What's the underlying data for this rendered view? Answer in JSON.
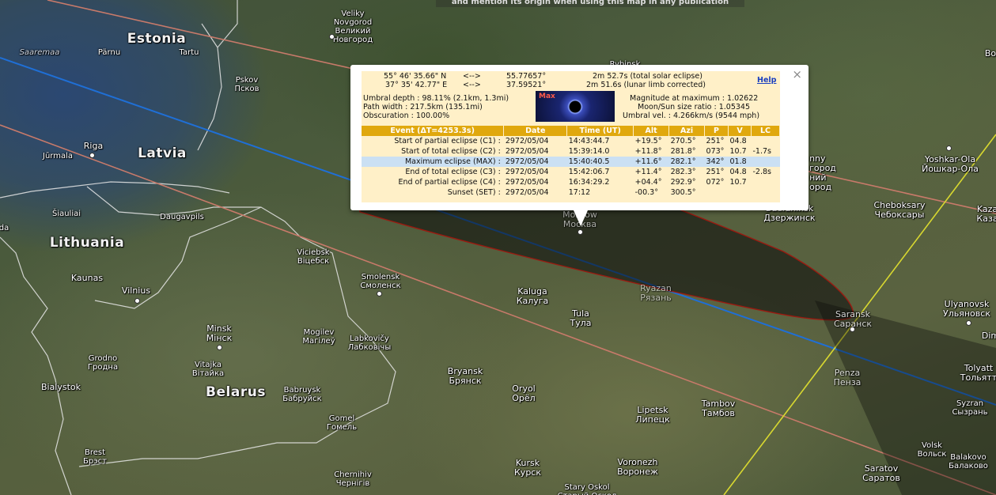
{
  "credit_text": "and mention its origin when using this map in any publication",
  "countries": [
    "Estonia",
    "Latvia",
    "Lithuania",
    "Belarus"
  ],
  "sea_labels": [
    "Saaremaa"
  ],
  "cities": [
    {
      "name": "Veliky\nNovgorod\nВеликий\nНовгород"
    },
    {
      "name": "Pärnu"
    },
    {
      "name": "Tartu"
    },
    {
      "name": "Pskov\nПсков"
    },
    {
      "name": "Jūrmala"
    },
    {
      "name": "Riga"
    },
    {
      "name": "Šiauliai"
    },
    {
      "name": "Daugavpils"
    },
    {
      "name": "Kaunas"
    },
    {
      "name": "Vilnius"
    },
    {
      "name": "Viciebsk\nВіцебск"
    },
    {
      "name": "Smolensk\nСмоленск"
    },
    {
      "name": "Minsk\nМінск"
    },
    {
      "name": "Mogilev\nМагілеў"
    },
    {
      "name": "Labkovičy\nЛабковічы"
    },
    {
      "name": "Grodno\nГродна"
    },
    {
      "name": "Vitajka\nВітайка"
    },
    {
      "name": "Bialystok"
    },
    {
      "name": "Babruysk\nБабруйск"
    },
    {
      "name": "Gomel\nГомель"
    },
    {
      "name": "Brest\nБрэст"
    },
    {
      "name": "Chernihiv\nЧернігів"
    },
    {
      "name": "Kaluga\nКалуга"
    },
    {
      "name": "Tula\nТула"
    },
    {
      "name": "Moscow\nМосква"
    },
    {
      "name": "Ryazan\nРязань"
    },
    {
      "name": "Bryansk\nБрянск"
    },
    {
      "name": "Oryol\nОрёл"
    },
    {
      "name": "Lipetsk\nЛипецк"
    },
    {
      "name": "Tambov\nТамбов"
    },
    {
      "name": "Kursk\nКурск"
    },
    {
      "name": "Voronezh\nВоронеж"
    },
    {
      "name": "Stary Oskol\nСтарый Оскол"
    },
    {
      "name": "Saransk\nСаранск"
    },
    {
      "name": "Penza\nПенза"
    },
    {
      "name": "Cheboksary\nЧебоксары"
    },
    {
      "name": "Yoshkar-Ola\nЙошкар-Ола"
    },
    {
      "name": "Ulyanovsk\nУльяновск"
    },
    {
      "name": "Tolyatt\nТольятт"
    },
    {
      "name": "Syzran\nСызрань"
    },
    {
      "name": "Saratov\nСаратов"
    },
    {
      "name": "Balakovo\nБалаково"
    },
    {
      "name": "Volsk\nВольск"
    },
    {
      "name": "Kaza\nКаза"
    },
    {
      "name": "Dim"
    },
    {
      "name": "Dzerzhinsk\nДзержинск"
    },
    {
      "name": "nny\nгород\nний\nород"
    },
    {
      "name": "Rybinsk"
    },
    {
      "name": "da"
    },
    {
      "name": "Bo"
    }
  ],
  "popup": {
    "coord_lat": "55° 46' 35.66\" N",
    "coord_lon": "37° 35' 42.77\" E",
    "arrow": "<-->",
    "lat_dec": "55.77657°",
    "lon_dec": "37.59521°",
    "duration_total": "2m 52.7s (total solar eclipse)",
    "duration_limb": "2m 51.6s (lunar limb corrected)",
    "help": "Help",
    "umbral_depth": "Umbral depth : 98.11% (2.1km, 1.3mi)",
    "path_width": "Path width : 217.5km (135.1mi)",
    "obscuration": "Obscuration : 100.00%",
    "max_label": "Max",
    "magnitude": "Magnitude at maximum : 1.02622",
    "ratio": "Moon/Sun size ratio : 1.05345",
    "umbral_vel": "Umbral vel. : 4.266km/s (9544 mph)",
    "close": "×",
    "headers": [
      "Event (ΔT=4253.3s)",
      "Date",
      "Time (UT)",
      "Alt",
      "Azi",
      "P",
      "V",
      "LC"
    ],
    "rows": [
      [
        "Start of partial eclipse (C1) :",
        "2972/05/04",
        "14:43:44.7",
        "+19.5°",
        "270.5°",
        "251°",
        "04.8",
        ""
      ],
      [
        "Start of total eclipse (C2) :",
        "2972/05/04",
        "15:39:14.0",
        "+11.8°",
        "281.8°",
        "073°",
        "10.7",
        "-1.7s"
      ],
      [
        "Maximum eclipse (MAX) :",
        "2972/05/04",
        "15:40:40.5",
        "+11.6°",
        "282.1°",
        "342°",
        "01.8",
        ""
      ],
      [
        "End of total eclipse (C3) :",
        "2972/05/04",
        "15:42:06.7",
        "+11.4°",
        "282.3°",
        "251°",
        "04.8",
        "-2.8s"
      ],
      [
        "End of partial eclipse (C4) :",
        "2972/05/04",
        "16:34:29.2",
        "+04.4°",
        "292.9°",
        "072°",
        "10.7",
        ""
      ],
      [
        "Sunset (SET) :",
        "2972/05/04",
        "17:12",
        "-00.3°",
        "300.5°",
        "",
        "",
        ""
      ]
    ]
  },
  "colors": {
    "central_line": "#1f6fd6",
    "path_limits": "#c87a6a",
    "ellipse": "#9a1a10",
    "other_line": "#d8d830",
    "highlight_row": "#cbe0f3",
    "header": "#e0a80e"
  }
}
